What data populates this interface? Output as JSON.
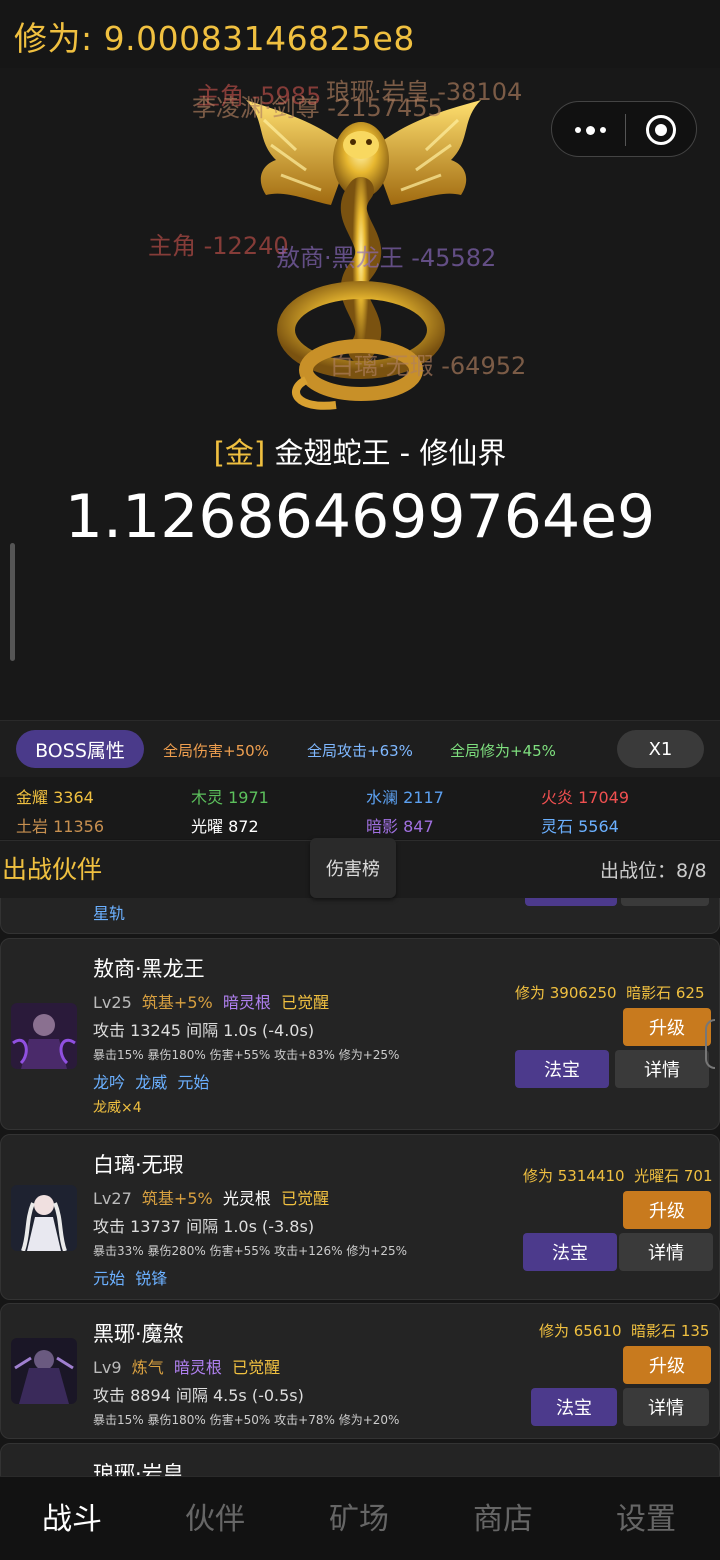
{
  "header": {
    "xiuwei": "修为: 9.00083146825e8"
  },
  "boss": {
    "name_tag": "[金]",
    "name": "金翅蛇王 - 修仙界",
    "hp": "1.126864699764e9",
    "damage_floats": [
      {
        "text": "主角 -5985",
        "color": "#c0504a"
      },
      {
        "text": "琅琊·岩皇 -38104",
        "color": "#b08060"
      },
      {
        "text": "李凌渊·剑尊 -2157455",
        "color": "#b08060"
      },
      {
        "text": "主角 -12240",
        "color": "#c0504a"
      },
      {
        "text": "敖商·黑龙王 -45582",
        "color": "#8c6cc0"
      },
      {
        "text": "白璃·无瑕 -64952",
        "color": "#b08060"
      }
    ]
  },
  "buffs": {
    "boss_attr": "BOSS属性",
    "items": [
      {
        "text": "全局伤害+50%",
        "color": "#f0a050"
      },
      {
        "text": "全局攻击+63%",
        "color": "#7fb8ff"
      },
      {
        "text": "全局修为+45%",
        "color": "#7fe07f"
      }
    ],
    "speed": "X1"
  },
  "elements": [
    {
      "name": "金耀",
      "value": "3364",
      "color": "#f0c040"
    },
    {
      "name": "木灵",
      "value": "1971",
      "color": "#5cc05c"
    },
    {
      "name": "水澜",
      "value": "2117",
      "color": "#5ca0f0"
    },
    {
      "name": "火炎",
      "value": "17049",
      "color": "#f05050"
    },
    {
      "name": "土岩",
      "value": "11356",
      "color": "#c89050"
    },
    {
      "name": "光曜",
      "value": "872",
      "color": "#ffffff"
    },
    {
      "name": "暗影",
      "value": "847",
      "color": "#a070e0"
    },
    {
      "name": "灵石",
      "value": "5564",
      "color": "#6bb0ff"
    }
  ],
  "partners_header": {
    "title": "出战伙伴",
    "rank_button": "伤害榜",
    "slots": "出战位：8/8"
  },
  "partial_top_skill": "星轨",
  "partners": [
    {
      "name": "敖商·黑龙王",
      "level": "Lv25",
      "realm": "筑基+5%",
      "root": "暗灵根",
      "root_color": "#b080f0",
      "awakened": "已觉醒",
      "attack": "攻击 13245  间隔 1.0s (-4.0s)",
      "stats": "暴击15% 暴伤180% 伤害+55% 攻击+83% 修为+25%",
      "skills": [
        "龙吟",
        "龙威",
        "元始"
      ],
      "extra": "龙威×4",
      "cost_xiuwei": "修为 3906250",
      "cost_stone": "暗影石 625",
      "upgrade": "升级",
      "fabao": "法宝",
      "detail": "详情"
    },
    {
      "name": "白璃·无瑕",
      "level": "Lv27",
      "realm": "筑基+5%",
      "root": "光灵根",
      "root_color": "#ffffff",
      "awakened": "已觉醒",
      "attack": "攻击 13737  间隔 1.0s (-3.8s)",
      "stats": "暴击33% 暴伤280% 伤害+55% 攻击+126% 修为+25%",
      "skills": [
        "元始",
        "锐锋"
      ],
      "cost_xiuwei": "修为 5314410",
      "cost_stone": "光曜石 701",
      "upgrade": "升级",
      "fabao": "法宝",
      "detail": "详情"
    },
    {
      "name": "黑琊·魔煞",
      "level": "Lv9",
      "realm": "炼气",
      "root": "暗灵根",
      "root_color": "#b080f0",
      "awakened": "已觉醒",
      "attack": "攻击 8894  间隔 4.5s (-0.5s)",
      "stats": "暴击15% 暴伤180% 伤害+50% 攻击+78% 修为+20%",
      "cost_xiuwei": "修为 65610",
      "cost_stone": "暗影石 135",
      "upgrade": "升级",
      "fabao": "法宝",
      "detail": "详情"
    }
  ],
  "partial_bottom_name": "琅琊·岩皇",
  "nav": {
    "items": [
      "战斗",
      "伙伴",
      "矿场",
      "商店",
      "设置"
    ],
    "active": "战斗"
  }
}
